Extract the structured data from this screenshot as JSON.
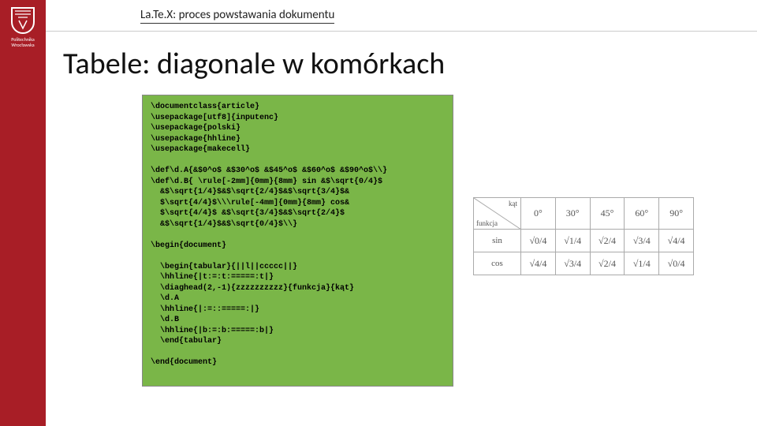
{
  "university": "Politechnika\nWrocławska",
  "header_title": "La.Te.X: proces powstawania dokumentu",
  "slide_title": "Tabele: diagonale w komórkach",
  "code": "\\documentclass{article}\n\\usepackage[utf8]{inputenc}\n\\usepackage{polski}\n\\usepackage{hhline}\n\\usepackage{makecell}\n\n\\def\\d.A{&$0^o$ &$30^o$ &$45^o$ &$60^o$ &$90^o$\\\\}\n\\def\\d.B{ \\rule[-2mm]{0mm}{8mm} sin &$\\sqrt{0/4}$\n  &$\\sqrt{1/4}$&$\\sqrt{2/4}$&$\\sqrt{3/4}$&\n  $\\sqrt{4/4}$\\\\\\rule[-4mm]{0mm}{8mm} cos&\n  $\\sqrt{4/4}$ &$\\sqrt{3/4}$&$\\sqrt{2/4}$\n  &$\\sqrt{1/4}$&$\\sqrt{0/4}$\\\\}\n\n\\begin{document}\n\n  \\begin{tabular}{||l||ccccc||}\n  \\hhline{|t:=:t:=====:t|}\n  \\diaghead(2,-1){zzzzzzzzzz}{funkcja}{kąt}\n  \\d.A\n  \\hhline{|:=::=====:|}\n  \\d.B\n  \\hhline{|b:=:b:=====:b|}\n  \\end{tabular}\n\n\\end{document}",
  "chart_data": {
    "type": "table",
    "diagonal_head": {
      "col_label": "kąt",
      "row_label": "funkcja"
    },
    "columns": [
      "0°",
      "30°",
      "45°",
      "60°",
      "90°"
    ],
    "rows": [
      {
        "name": "sin",
        "cells": [
          "√0/4",
          "√1/4",
          "√2/4",
          "√3/4",
          "√4/4"
        ]
      },
      {
        "name": "cos",
        "cells": [
          "√4/4",
          "√3/4",
          "√2/4",
          "√1/4",
          "√0/4"
        ]
      }
    ]
  }
}
